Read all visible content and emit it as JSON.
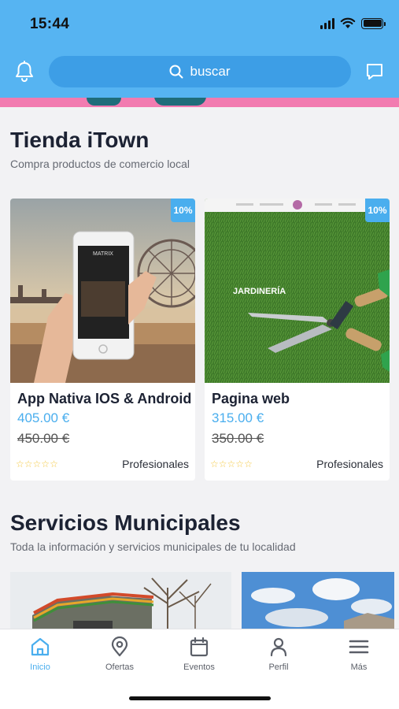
{
  "status_bar": {
    "time": "15:44"
  },
  "header": {
    "search_placeholder": "buscar"
  },
  "shop": {
    "title": "Tienda iTown",
    "subtitle": "Compra productos de comercio local",
    "products": [
      {
        "title": "App Nativa IOS & Android",
        "price": "405.00 €",
        "old_price": "450.00 €",
        "discount": "10%",
        "category": "Profesionales",
        "rating_stars": 5,
        "image": "hand-holding-phone-photo"
      },
      {
        "title": "Pagina web",
        "price": "315.00 €",
        "old_price": "350.00 €",
        "discount": "10%",
        "category": "Profesionales",
        "rating_stars": 5,
        "image": "garden-shears-website-photo",
        "image_caption": "JARDINERÍA"
      }
    ]
  },
  "services": {
    "title": "Servicios Municipales",
    "subtitle": "Toda la información y servicios municipales de tu localidad"
  },
  "tabbar": {
    "tabs": [
      {
        "label": "Inicio",
        "icon": "home-icon",
        "active": true
      },
      {
        "label": "Ofertas",
        "icon": "map-pin-icon",
        "active": false
      },
      {
        "label": "Eventos",
        "icon": "calendar-icon",
        "active": false
      },
      {
        "label": "Perfil",
        "icon": "user-icon",
        "active": false
      },
      {
        "label": "Más",
        "icon": "menu-icon",
        "active": false
      }
    ]
  },
  "colors": {
    "accent": "#4aaeee",
    "header": "#56b4f2",
    "search": "#3d9ee6",
    "banner": "#f27bb0"
  }
}
